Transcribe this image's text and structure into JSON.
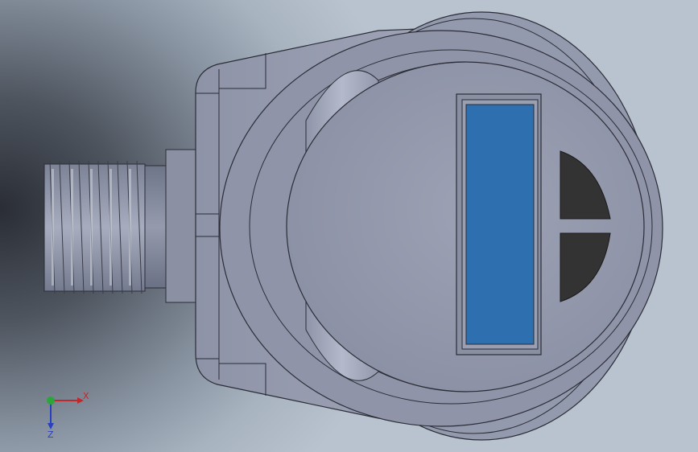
{
  "viewport": {
    "type": "cad-3d-view"
  },
  "model": {
    "display_color": "#2e6fb0"
  },
  "triad": {
    "x_label": "X",
    "z_label": "Z",
    "x_color": "#c0282d",
    "y_color": "#2aa63a",
    "z_color": "#2a3fc0"
  }
}
